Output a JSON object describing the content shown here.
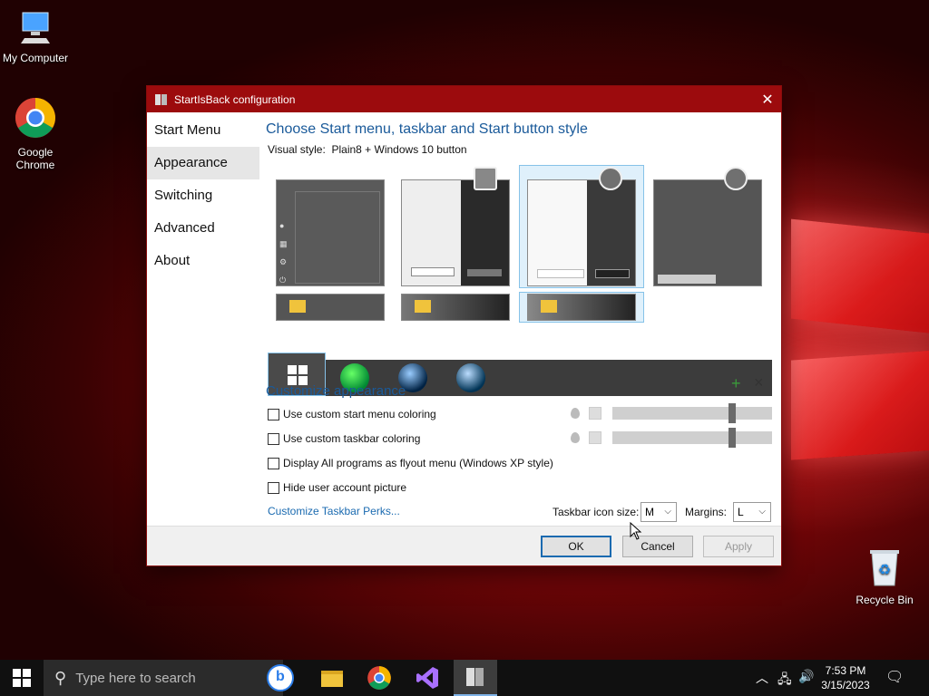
{
  "desktop": {
    "icons": [
      {
        "label": "My Computer"
      },
      {
        "label": "Google\nChrome",
        "line1": "Google",
        "line2": "Chrome"
      },
      {
        "label": "Recycle Bin"
      }
    ]
  },
  "dialog": {
    "title": "StartIsBack configuration",
    "nav": [
      "Start Menu",
      "Appearance",
      "Switching",
      "Advanced",
      "About"
    ],
    "active_nav": "Appearance",
    "heading": "Choose Start menu, taskbar and Start button style",
    "visual_style_label": "Visual style:",
    "visual_style_value": "Plain8 + Windows 10 button",
    "customize_heading": "Customize appearance",
    "checkboxes": [
      {
        "label": "Use custom start menu coloring",
        "checked": false
      },
      {
        "label": "Use custom taskbar coloring",
        "checked": false
      },
      {
        "label": "Display All programs as flyout menu (Windows XP style)",
        "checked": false
      },
      {
        "label": "Hide user account picture",
        "checked": false
      }
    ],
    "customize_link": "Customize Taskbar Perks...",
    "taskbar_icon_size_label": "Taskbar icon size:",
    "taskbar_icon_size_value": "M",
    "margins_label": "Margins:",
    "margins_value": "L",
    "buttons": {
      "ok": "OK",
      "cancel": "Cancel",
      "apply": "Apply"
    },
    "add_symbol": "+",
    "remove_symbol": "×"
  },
  "taskbar": {
    "search_placeholder": "Type here to search",
    "time": "7:53 PM",
    "date": "3/15/2023"
  },
  "colors": {
    "titlebar": "#9c0b0d",
    "accent_text": "#1a5a9a",
    "link": "#1a6ab0"
  }
}
